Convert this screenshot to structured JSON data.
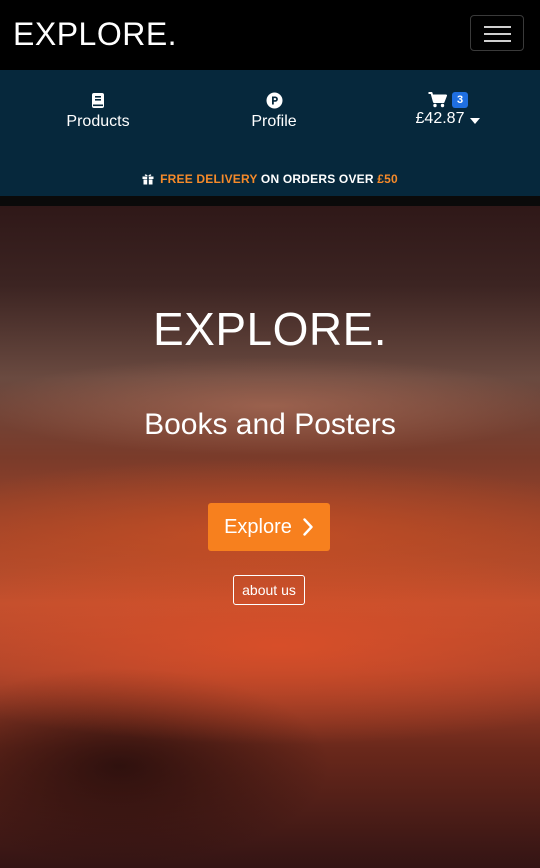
{
  "navbar": {
    "brand": "EXPLORE."
  },
  "nav": {
    "items": [
      {
        "label": "Products",
        "icon": "book-icon"
      },
      {
        "label": "Profile",
        "icon": "p-circle-icon"
      }
    ],
    "cart": {
      "icon": "cart-icon",
      "count": "3",
      "amount": "£42.87"
    }
  },
  "delivery": {
    "prefix": "FREE DELIVERY",
    "middle": " ON ORDERS OVER ",
    "amount": "£50"
  },
  "hero": {
    "title": "EXPLORE.",
    "subtitle": "Books and Posters",
    "explore_button": "Explore",
    "about_button": "about us"
  },
  "colors": {
    "accent": "#f7801e",
    "navstrip": "#06283c",
    "badge": "#1f6fe0"
  }
}
